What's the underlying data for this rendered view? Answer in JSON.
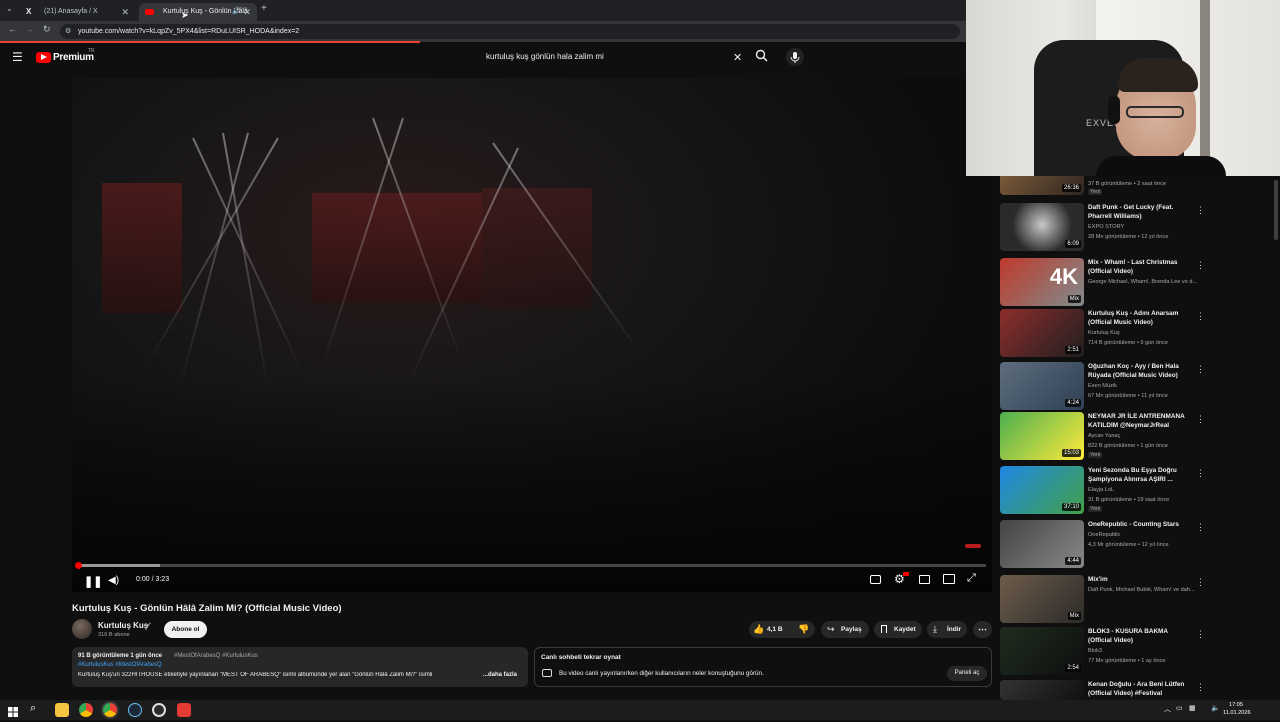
{
  "browser": {
    "tabs": [
      {
        "label": "(21) Anasayfa / X",
        "icon": "x-logo-icon"
      },
      {
        "label": "Kurtuluş Kuş - Gönlün Hâlâ",
        "icon": "youtube-logo-icon"
      }
    ],
    "url": "youtube.com/watch?v=kLqpZv_5PX4&list=RDuLUISR_HODA&index=2"
  },
  "header": {
    "logo": "Premium",
    "logo_badge": "TR",
    "search_value": "kurtuluş kuş gönlün hala zalim mi"
  },
  "player": {
    "time": "0:00 / 3:23",
    "progress": 0.0
  },
  "video": {
    "title": "Kurtuluş Kuş - Gönlün Hâlâ Zalim Mi? (Official Music Video)",
    "channel": "Kurtuluş Kuş",
    "subscribers": "316 B abone",
    "subscribe_label": "Abone ol",
    "likes": "4,1 B",
    "share_label": "Paylaş",
    "save_label": "Kaydet",
    "download_label": "İndir",
    "desc_stats": "91 B görüntüleme  1 gün önce",
    "desc_tags1": "#MestOfArabesQ #KurtulusKus",
    "desc_tags2": "#KurtulusKus #MestOfArabesQ",
    "desc_text": "Kurtuluş Kuş'un 322HİTHOUSE etiketiyle yayınlanan \"MEST OF ARABESQ\" isimli albümünde yer alan \"Gönlün Hâlâ Zalim Mi?\" isimli",
    "desc_more": "...daha fazla"
  },
  "chat": {
    "title": "Canlı sohbeti tekrar oynat",
    "text": "Bu video canlı yayınlanırken diğer kullanıcıların neler konuştuğunu görün.",
    "button": "Paneli aç"
  },
  "recommendations": [
    {
      "title": "",
      "channel": "",
      "meta": "37 B görüntüleme • 2 saat önce",
      "duration": "26:36",
      "badge": "Yeni"
    },
    {
      "title": "Daft Punk - Get Lucky (Feat. Pharrell Williams)",
      "channel": "EXPO STORY",
      "meta": "28 Mn görüntüleme • 12 yıl önce",
      "duration": "6:09",
      "badge": ""
    },
    {
      "title": "Mix - Wham! - Last Christmas (Official Video)",
      "channel": "George Michael, Wham!, Brenda Lee ve d...",
      "meta": "",
      "duration": "Mix",
      "badge": ""
    },
    {
      "title": "Kurtuluş Kuş - Adını Anarsam (Official Music Video)",
      "channel": "Kurtuluş Kuş",
      "meta": "714 B görüntüleme • 9 gün önce",
      "duration": "2:51",
      "badge": ""
    },
    {
      "title": "Oğuzhan Koç - Ayy / Ben Hala Rüyada (Official Music Video)",
      "channel": "Esen Müzik",
      "meta": "67 Mn görüntüleme • 11 yıl önce",
      "duration": "4:24",
      "badge": ""
    },
    {
      "title": "NEYMAR JR İLE ANTRENMANA KATILDIM @NeymarJrReal",
      "channel": "Aycan Yanaç",
      "meta": "822 B görüntüleme • 1 gün önce",
      "duration": "15:03",
      "badge": "Yeni"
    },
    {
      "title": "Yeni Sezonda Bu Eşya Doğru Şampiyona Alınırsa AŞIRI ...",
      "channel": "Elayja LoL",
      "meta": "31 B görüntüleme • 19 saat önce",
      "duration": "37:10",
      "badge": "Yeni"
    },
    {
      "title": "OneRepublic - Counting Stars",
      "channel": "OneRepublic",
      "meta": "4,3 Mr görüntüleme • 12 yıl önce",
      "duration": "4:44",
      "badge": ""
    },
    {
      "title": "Mix'im",
      "channel": "Daft Punk, Michael Bublé, Wham! ve dah...",
      "meta": "",
      "duration": "Mix",
      "badge": ""
    },
    {
      "title": "BLOK3 - KUSURA BAKMA (Official Video)",
      "channel": "Blok3",
      "meta": "77 Mn görüntüleme • 1 ay önce",
      "duration": "2:54",
      "badge": ""
    },
    {
      "title": "Kenan Doğulu - Ara Beni Lütfen (Official Video) #Festival",
      "channel": "",
      "meta": "",
      "duration": "",
      "badge": ""
    }
  ],
  "camera": {
    "overlay_text": "EXVESR"
  },
  "taskbar": {
    "time": "17:05",
    "date": "11.01.2026"
  },
  "colors": {
    "accent": "#ff0000",
    "background": "#0f0f0f"
  }
}
